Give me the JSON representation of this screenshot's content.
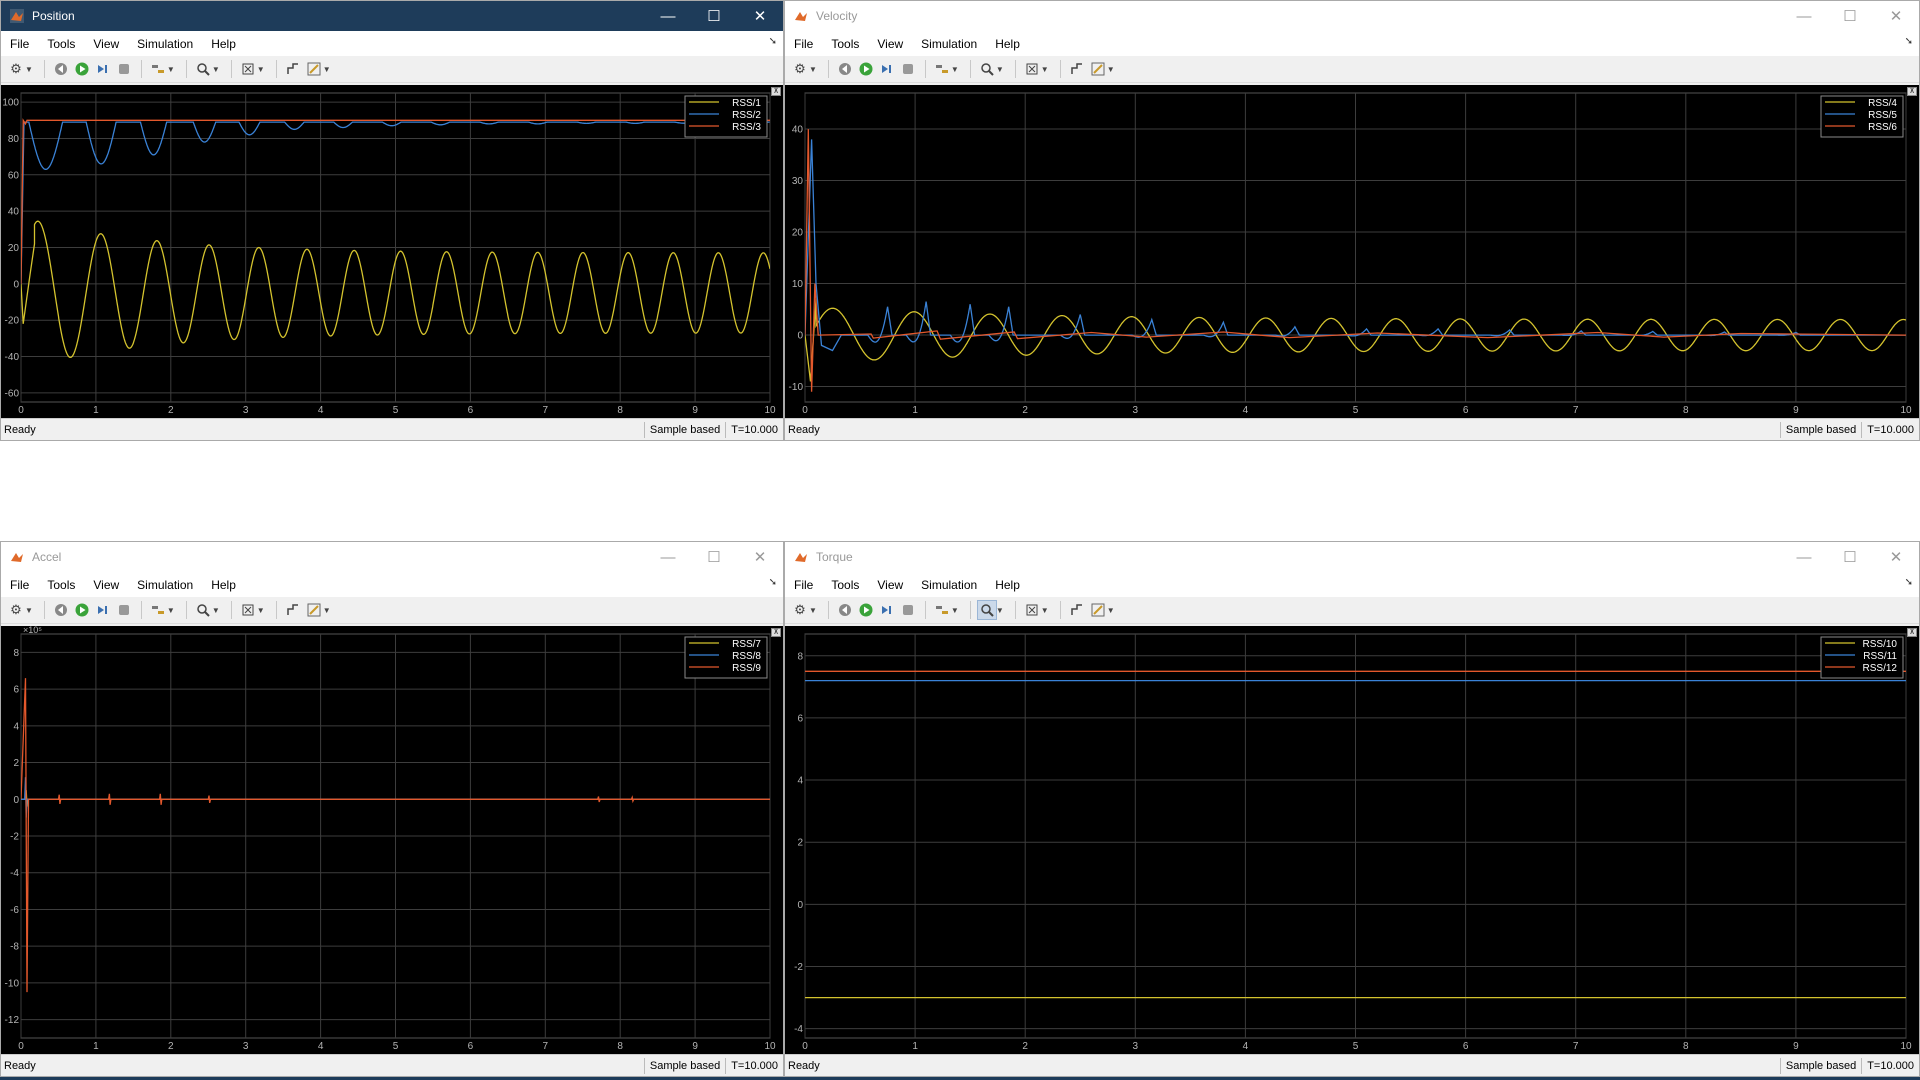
{
  "menu": [
    "File",
    "Tools",
    "View",
    "Simulation",
    "Help"
  ],
  "window_controls": {
    "minimize": "—",
    "maximize": "☐",
    "close": "✕"
  },
  "status": {
    "text": "Ready",
    "mode": "Sample based",
    "time": "T=10.000"
  },
  "colors": {
    "plot_bg": "#000000",
    "grid": "#3d3d3d",
    "axis_text": "#b4b4b4",
    "series1": "#d4c32e",
    "series2": "#3a82d6",
    "series3": "#e3582c",
    "active_title": "#1e3c5a"
  },
  "windows": [
    {
      "title": "Position",
      "active": true,
      "zoom_pressed": false
    },
    {
      "title": "Velocity",
      "active": false,
      "zoom_pressed": false
    },
    {
      "title": "Accel",
      "active": false,
      "zoom_pressed": false
    },
    {
      "title": "Torque",
      "active": false,
      "zoom_pressed": true
    }
  ],
  "chart_data": [
    {
      "type": "line",
      "title": "",
      "xlabel": "",
      "ylabel": "",
      "xlim": [
        0,
        10
      ],
      "ylim": [
        -65,
        105
      ],
      "xticks": [
        0,
        1,
        2,
        3,
        4,
        5,
        6,
        7,
        8,
        9,
        10
      ],
      "yticks": [
        -60,
        -40,
        -20,
        0,
        20,
        40,
        60,
        80,
        100
      ],
      "exponent_label": "",
      "grid": true,
      "legend_position": "top-right",
      "series": [
        {
          "name": "RSS/1",
          "color": "#d4c32e",
          "kind": "damped_sine",
          "params": {
            "offset": -5,
            "amp0": 42,
            "amp_inf": 22,
            "decay": 0.6,
            "period0": 0.95,
            "period_inf": 0.6,
            "phase": 1.2,
            "start": [
              [
                0,
                0
              ],
              [
                0.03,
                -22
              ],
              [
                0.12,
                5
              ],
              [
                0.18,
                22
              ]
            ]
          }
        },
        {
          "name": "RSS/2",
          "color": "#3a82d6",
          "kind": "notch_train",
          "params": {
            "base": 89,
            "start": [
              [
                0,
                0
              ],
              [
                0.04,
                89
              ]
            ],
            "notches": [
              [
                0.33,
                63,
                0.45
              ],
              [
                1.07,
                66,
                0.4
              ],
              [
                1.77,
                71,
                0.35
              ],
              [
                2.45,
                78,
                0.3
              ],
              [
                3.05,
                82,
                0.28
              ],
              [
                3.65,
                85,
                0.26
              ],
              [
                4.3,
                86,
                0.25
              ],
              [
                4.95,
                87,
                0.25
              ],
              [
                5.6,
                87.5,
                0.25
              ],
              [
                6.25,
                88,
                0.25
              ],
              [
                6.9,
                88,
                0.25
              ],
              [
                7.55,
                88.3,
                0.25
              ],
              [
                8.2,
                88.3,
                0.25
              ],
              [
                8.85,
                88.4,
                0.25
              ],
              [
                9.5,
                88.4,
                0.25
              ]
            ]
          }
        },
        {
          "name": "RSS/3",
          "color": "#e3582c",
          "kind": "points",
          "params": {
            "points": [
              [
                0,
                0
              ],
              [
                0.03,
                90
              ],
              [
                0.06,
                88
              ],
              [
                0.08,
                90
              ],
              [
                10,
                90
              ]
            ]
          }
        }
      ]
    },
    {
      "type": "line",
      "title": "",
      "xlabel": "",
      "ylabel": "",
      "xlim": [
        0,
        10
      ],
      "ylim": [
        -13,
        47
      ],
      "xticks": [
        0,
        1,
        2,
        3,
        4,
        5,
        6,
        7,
        8,
        9,
        10
      ],
      "yticks": [
        -10,
        0,
        10,
        20,
        30,
        40
      ],
      "exponent_label": "",
      "grid": true,
      "legend_position": "top-right",
      "series": [
        {
          "name": "RSS/4",
          "color": "#d4c32e",
          "kind": "damped_sine",
          "params": {
            "offset": 0,
            "amp0": 5.5,
            "amp_inf": 3,
            "decay": 0.5,
            "period0": 0.8,
            "period_inf": 0.57,
            "phase": 0.3,
            "start": [
              [
                0,
                0
              ],
              [
                0.05,
                -9
              ],
              [
                0.1,
                7
              ]
            ]
          }
        },
        {
          "name": "RSS/5",
          "color": "#3a82d6",
          "kind": "spike_train",
          "params": {
            "start": [
              [
                0,
                0
              ],
              [
                0.06,
                38
              ],
              [
                0.1,
                10
              ],
              [
                0.15,
                -2
              ],
              [
                0.25,
                -3
              ],
              [
                0.33,
                0
              ]
            ],
            "spikes": [
              [
                0.75,
                5.5,
                -3
              ],
              [
                1.1,
                6.5,
                -3
              ],
              [
                1.5,
                6,
                -3
              ],
              [
                1.85,
                5.5,
                -2.5
              ],
              [
                2.5,
                4,
                -1.5
              ],
              [
                3.15,
                3,
                -1
              ],
              [
                3.8,
                2.5,
                -0.8
              ],
              [
                4.45,
                1.6,
                -0.5
              ],
              [
                5.1,
                1.2,
                -0.4
              ],
              [
                5.75,
                1.2,
                -0.3
              ],
              [
                6.4,
                1,
                -0.3
              ],
              [
                7.05,
                0.8,
                -0.2
              ],
              [
                7.7,
                0.7,
                -0.2
              ],
              [
                8.35,
                0.6,
                -0.2
              ],
              [
                9.0,
                0.5,
                -0.1
              ]
            ]
          }
        },
        {
          "name": "RSS/6",
          "color": "#e3582c",
          "kind": "points",
          "params": {
            "points": [
              [
                0,
                0
              ],
              [
                0.03,
                40
              ],
              [
                0.06,
                -11
              ],
              [
                0.09,
                10
              ],
              [
                0.12,
                0
              ],
              [
                0.6,
                0.2
              ],
              [
                0.62,
                -0.6
              ],
              [
                1.2,
                0.8
              ],
              [
                1.23,
                -0.8
              ],
              [
                1.9,
                0.6
              ],
              [
                1.93,
                -0.7
              ],
              [
                2.6,
                0.5
              ],
              [
                3.1,
                -0.4
              ],
              [
                3.8,
                0.6
              ],
              [
                4.4,
                -0.5
              ],
              [
                5.2,
                0.4
              ],
              [
                6.2,
                -0.5
              ],
              [
                7.2,
                0.5
              ],
              [
                7.8,
                -0.4
              ],
              [
                8.5,
                0.3
              ],
              [
                10,
                0
              ]
            ]
          }
        }
      ]
    },
    {
      "type": "line",
      "title": "",
      "xlabel": "",
      "ylabel": "",
      "xlim": [
        0,
        10
      ],
      "ylim": [
        -13,
        9
      ],
      "xticks": [
        0,
        1,
        2,
        3,
        4,
        5,
        6,
        7,
        8,
        9,
        10
      ],
      "yticks": [
        -12,
        -10,
        -8,
        -6,
        -4,
        -2,
        0,
        2,
        4,
        6,
        8
      ],
      "exponent_label": "×10⁵",
      "grid": true,
      "legend_position": "top-right",
      "series": [
        {
          "name": "RSS/7",
          "color": "#d4c32e",
          "kind": "points",
          "params": {
            "points": [
              [
                0,
                0
              ],
              [
                0.06,
                0
              ],
              [
                0.07,
                0.5
              ],
              [
                0.08,
                -0.4
              ],
              [
                0.09,
                0
              ],
              [
                10,
                0
              ]
            ]
          }
        },
        {
          "name": "RSS/8",
          "color": "#3a82d6",
          "kind": "points",
          "params": {
            "points": [
              [
                0,
                0
              ],
              [
                0.05,
                0
              ],
              [
                0.06,
                1.2
              ],
              [
                0.07,
                -1
              ],
              [
                0.08,
                0
              ],
              [
                10,
                0
              ]
            ]
          }
        },
        {
          "name": "RSS/9",
          "color": "#e3582c",
          "kind": "points",
          "params": {
            "points": [
              [
                0,
                0
              ],
              [
                0.06,
                6.6
              ],
              [
                0.08,
                -10.5
              ],
              [
                0.1,
                0
              ],
              [
                0.5,
                0
              ],
              [
                0.51,
                0.25
              ],
              [
                0.52,
                -0.25
              ],
              [
                0.53,
                0
              ],
              [
                1.17,
                0
              ],
              [
                1.18,
                0.3
              ],
              [
                1.19,
                -0.3
              ],
              [
                1.2,
                0
              ],
              [
                1.85,
                0
              ],
              [
                1.86,
                0.3
              ],
              [
                1.87,
                -0.3
              ],
              [
                1.88,
                0
              ],
              [
                2.5,
                0
              ],
              [
                2.51,
                0.2
              ],
              [
                2.52,
                -0.2
              ],
              [
                2.53,
                0
              ],
              [
                7.7,
                0
              ],
              [
                7.71,
                0.15
              ],
              [
                7.72,
                -0.15
              ],
              [
                7.73,
                0
              ],
              [
                8.15,
                0
              ],
              [
                8.16,
                0.1
              ],
              [
                8.17,
                -0.1
              ],
              [
                8.18,
                0
              ],
              [
                10,
                0
              ]
            ]
          }
        }
      ]
    },
    {
      "type": "line",
      "title": "",
      "xlabel": "",
      "ylabel": "",
      "xlim": [
        0,
        10
      ],
      "ylim": [
        -4.3,
        8.7
      ],
      "xticks": [
        0,
        1,
        2,
        3,
        4,
        5,
        6,
        7,
        8,
        9,
        10
      ],
      "yticks": [
        -4,
        -2,
        0,
        2,
        4,
        6,
        8
      ],
      "exponent_label": "",
      "grid": true,
      "legend_position": "top-right",
      "series": [
        {
          "name": "RSS/10",
          "color": "#d4c32e",
          "kind": "points",
          "params": {
            "points": [
              [
                0,
                -3
              ],
              [
                10,
                -3
              ]
            ]
          }
        },
        {
          "name": "RSS/11",
          "color": "#3a82d6",
          "kind": "points",
          "params": {
            "points": [
              [
                0,
                7.2
              ],
              [
                10,
                7.2
              ]
            ]
          }
        },
        {
          "name": "RSS/12",
          "color": "#e3582c",
          "kind": "points",
          "params": {
            "points": [
              [
                0,
                7.5
              ],
              [
                10,
                7.5
              ]
            ]
          }
        }
      ]
    }
  ]
}
